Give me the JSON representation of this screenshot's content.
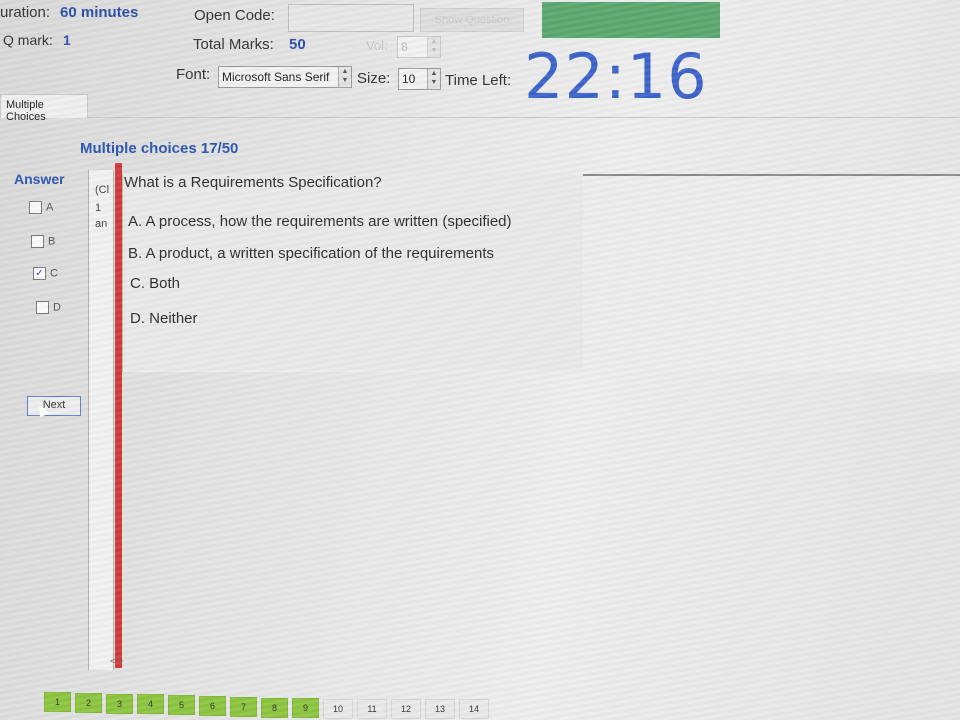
{
  "header": {
    "duration_label": "uration:",
    "duration_value": "60 minutes",
    "qmark_label": "Q mark:",
    "qmark_value": "1",
    "open_code_label": "Open Code:",
    "open_code_value": "",
    "show_button_label": "Show Question",
    "total_marks_label": "Total Marks:",
    "total_marks_value": "50",
    "vol_label": "Vol:",
    "vol_value": "8",
    "font_label": "Font:",
    "font_value": "Microsoft Sans Serif",
    "size_label": "Size:",
    "size_value": "10",
    "time_left_label": "Time Left:",
    "time_left_value": "22:16",
    "status_color": "#5aa86e"
  },
  "tabs": [
    {
      "label": "Multiple Choices"
    }
  ],
  "section": {
    "title": "Multiple choices 17/50"
  },
  "answer_panel": {
    "heading": "Answer",
    "options": [
      {
        "label": "A",
        "checked": false
      },
      {
        "label": "B",
        "checked": false
      },
      {
        "label": "C",
        "checked": true
      },
      {
        "label": "D",
        "checked": false
      }
    ],
    "next_label": "Next"
  },
  "left_pane": {
    "line1": "(Cl",
    "line2": "1",
    "line3": "an"
  },
  "question": {
    "text": "What is a Requirements Specification?",
    "choices": [
      "A.  A process, how the requirements are written (specified)",
      "B.  A product, a written specification of the requirements",
      "C.  Both",
      "D.  Neither"
    ],
    "scroll_hint": "< >"
  },
  "question_nav": [
    "1",
    "2",
    "3",
    "4",
    "5",
    "6",
    "7",
    "8",
    "9",
    "10",
    "11",
    "12",
    "13",
    "14"
  ],
  "colors": {
    "accent_blue": "#2a55b0",
    "timer_blue": "#3b63c9",
    "rule_red": "#d23a3a",
    "nav_answered": "#8cc63f"
  }
}
